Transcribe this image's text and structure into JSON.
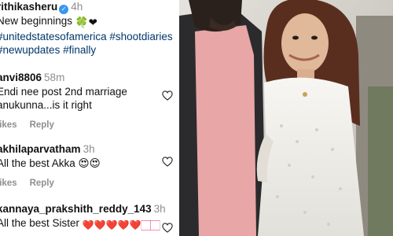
{
  "post": {
    "username": "rithikasheru",
    "time": "4h",
    "caption_line1": "New beginnings",
    "caption_line1_emojis": "🍀❤",
    "hashtag_line2": "#unitedstatesofamerica #shootdiaries",
    "hashtag_line3": "#newupdates #finally"
  },
  "comments": [
    {
      "username": "anvi8806",
      "time": "58m",
      "lines": [
        "Endi nee post 2nd marriage",
        "anukunna...is it right"
      ],
      "likes_label": "likes",
      "reply_label": "Reply"
    },
    {
      "username": "akhilaparvatham",
      "time": "3h",
      "lines": [
        "All the best Akka 😍😍"
      ],
      "likes_label": "likes",
      "reply_label": "Reply"
    },
    {
      "username": "kannaya_prakshith_reddy_143",
      "time": "3h",
      "lines": [
        "All the best Sister"
      ],
      "emojis": "❤️❤️❤️❤️❤️🏻🏻"
    }
  ],
  "icons": {
    "heart": "heart-outline-icon",
    "verified": "verified-badge-icon"
  },
  "colors": {
    "hashtag": "#00376b",
    "muted": "#8e8e8e",
    "verified": "#3897f0",
    "heart_emoji": "#e0245e"
  }
}
